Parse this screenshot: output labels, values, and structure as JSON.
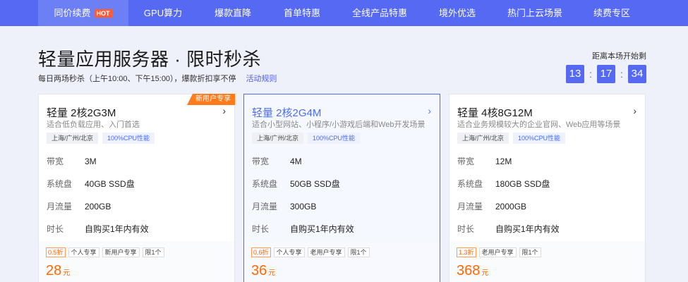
{
  "nav": {
    "items": [
      {
        "label": "同价续费",
        "badge": "HOT",
        "active": true
      },
      {
        "label": "GPU算力"
      },
      {
        "label": "爆款直降"
      },
      {
        "label": "首单特惠"
      },
      {
        "label": "全线产品特惠"
      },
      {
        "label": "境外优选"
      },
      {
        "label": "热门上云场景"
      },
      {
        "label": "续费专区"
      }
    ]
  },
  "header": {
    "title": "轻量应用服务器 · 限时秒杀",
    "subtitle": "每日两场秒杀（上午10:00、下午15:00），爆款折扣享不停",
    "rules_link": "活动规则"
  },
  "countdown": {
    "label": "距离本场开始剩",
    "hours": "13",
    "minutes": "17",
    "seconds": "34",
    "separator": ":"
  },
  "cards": [
    {
      "ribbon": "新用户专享",
      "title": "轻量 2核2G3M",
      "desc": "适合低负载应用、入门首选",
      "region": "上海/广州/北京",
      "cpu_tag": "100%CPU性能",
      "specs": [
        {
          "k": "带宽",
          "v": "3M"
        },
        {
          "k": "系统盘",
          "v": "40GB SSD盘"
        },
        {
          "k": "月流量",
          "v": "200GB"
        },
        {
          "k": "时长",
          "v": "自购买1年内有效"
        }
      ],
      "discount": "0.5折",
      "badges": [
        "个人专享",
        "新用户专享",
        "限1个"
      ],
      "price": "28",
      "unit": "元",
      "arrow": "›"
    },
    {
      "title": "轻量 2核2G4M",
      "desc": "适合小型网站、小程序/小游戏后端和Web开发场景",
      "region": "上海/广州/北京",
      "cpu_tag": "100%CPU性能",
      "specs": [
        {
          "k": "带宽",
          "v": "4M"
        },
        {
          "k": "系统盘",
          "v": "50GB SSD盘"
        },
        {
          "k": "月流量",
          "v": "300GB"
        },
        {
          "k": "时长",
          "v": "自购买1年内有效"
        }
      ],
      "discount": "0.6折",
      "badges": [
        "个人专享",
        "老用户专享",
        "限1个"
      ],
      "price": "36",
      "unit": "元",
      "arrow": "›"
    },
    {
      "title": "轻量 4核8G12M",
      "desc": "适合业务规模较大的企业官网、Web应用等场景",
      "region": "上海/广州/北京",
      "cpu_tag": "100%CPU性能",
      "specs": [
        {
          "k": "带宽",
          "v": "12M"
        },
        {
          "k": "系统盘",
          "v": "180GB SSD盘"
        },
        {
          "k": "月流量",
          "v": "2000GB"
        },
        {
          "k": "时长",
          "v": "自购买1年内有效"
        }
      ],
      "discount": "1.3折",
      "badges": [
        "老用户专享",
        "限1个"
      ],
      "price": "368",
      "unit": "元",
      "arrow": "›"
    }
  ],
  "colors": {
    "nav_bg": "#5569f2",
    "accent": "#4d6df0",
    "price": "#ff6a00",
    "ribbon": "#ff7b1c",
    "hot": "#ff5b36"
  }
}
